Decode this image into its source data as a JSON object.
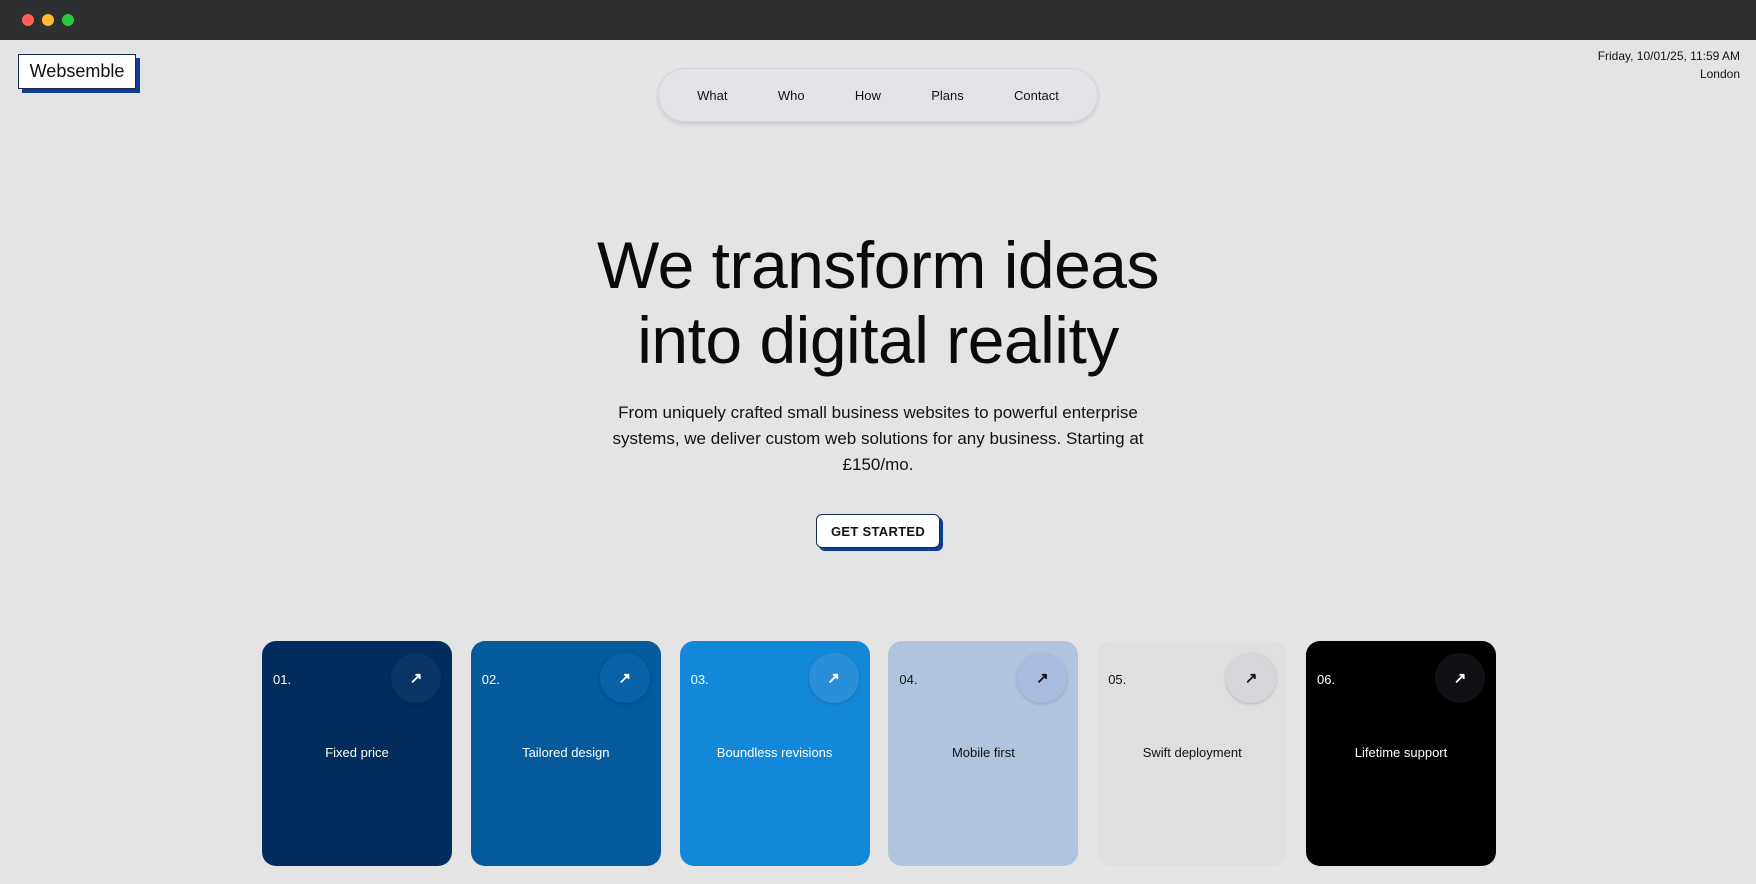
{
  "brand": {
    "name": "Websemble"
  },
  "nav": {
    "items": [
      "What",
      "Who",
      "How",
      "Plans",
      "Contact"
    ]
  },
  "datetime": {
    "stamp": "Friday, 10/01/25, 11:59 AM",
    "city": "London"
  },
  "hero": {
    "title_line1": "We transform ideas",
    "title_line2": "into digital reality",
    "subtitle": "From uniquely crafted small business websites to powerful enterprise systems, we deliver custom web solutions for any business. Starting at £150/mo.",
    "cta_label": "GET STARTED"
  },
  "cards": [
    {
      "num": "01.",
      "label": "Fixed price",
      "bg": "#012c5c",
      "fg": "#ffffff",
      "btn": "#0b3566",
      "icon": "arrow-up-right-icon"
    },
    {
      "num": "02.",
      "label": "Tailored design",
      "bg": "#045a9b",
      "fg": "#ffffff",
      "btn": "#0a62a6",
      "icon": "arrow-up-right-icon"
    },
    {
      "num": "03.",
      "label": "Boundless revisions",
      "bg": "#1488d8",
      "fg": "#ffffff",
      "btn": "#2a8fdb",
      "icon": "arrow-up-right-icon"
    },
    {
      "num": "04.",
      "label": "Mobile first",
      "bg": "#b1c4df",
      "fg": "#111111",
      "btn": "#a8bce0",
      "icon": "arrow-up-right-icon"
    },
    {
      "num": "05.",
      "label": "Swift deployment",
      "bg": "#dfdfe0",
      "fg": "#111111",
      "btn": "#d6d7da",
      "icon": "arrow-up-right-icon"
    },
    {
      "num": "06.",
      "label": "Lifetime support",
      "bg": "#000000",
      "fg": "#ffffff",
      "btn": "#0f1013",
      "icon": "arrow-up-right-icon"
    }
  ],
  "colors": {
    "accent_shadow": "#0d3f91",
    "page_bg": "#e4e4e5"
  }
}
